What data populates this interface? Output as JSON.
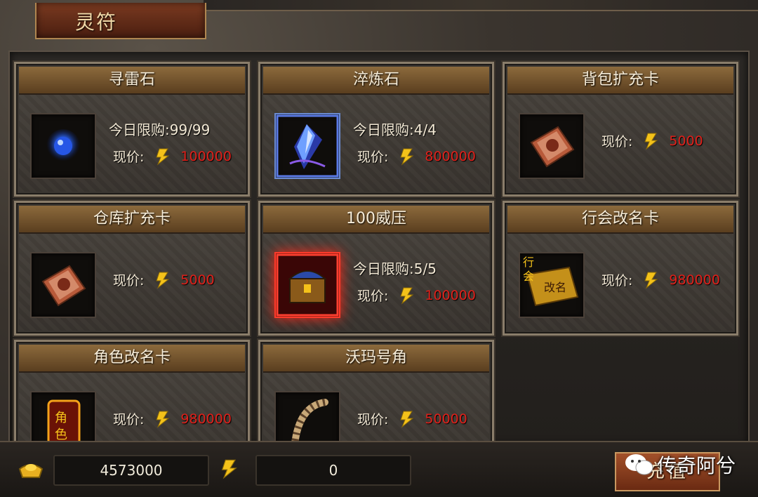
{
  "window": {
    "title": "灵符"
  },
  "items": [
    {
      "name": "寻雷石",
      "limit": "今日限购:99/99",
      "price_label": "现价:",
      "price": "100000",
      "icon": "blue-orb-icon"
    },
    {
      "name": "淬炼石",
      "limit": "今日限购:4/4",
      "price_label": "现价:",
      "price": "800000",
      "icon": "crystal-shard-icon"
    },
    {
      "name": "背包扩充卡",
      "limit": "",
      "price_label": "现价:",
      "price": "5000",
      "icon": "scroll-card-icon"
    },
    {
      "name": "仓库扩充卡",
      "limit": "",
      "price_label": "现价:",
      "price": "5000",
      "icon": "scroll-card-icon"
    },
    {
      "name": "100威压",
      "limit": "今日限购:5/5",
      "price_label": "现价:",
      "price": "100000",
      "icon": "treasure-chest-icon"
    },
    {
      "name": "行会改名卡",
      "limit": "",
      "price_label": "现价:",
      "price": "980000",
      "icon": "guild-rename-card-icon",
      "icon_text": [
        "行",
        "会",
        "改名"
      ]
    },
    {
      "name": "角色改名卡",
      "limit": "",
      "price_label": "现价:",
      "price": "980000",
      "icon": "role-rename-card-icon",
      "icon_text": [
        "角",
        "色"
      ]
    },
    {
      "name": "沃玛号角",
      "limit": "",
      "price_label": "现价:",
      "price": "50000",
      "icon": "horn-icon"
    }
  ],
  "footer": {
    "ingot_amount": "4573000",
    "voucher_amount": "0",
    "recharge_label": "充值",
    "watermark": "传奇阿兮"
  },
  "colors": {
    "price": "#e0201a",
    "card_header": "#8c6a3c",
    "accent_gold": "#f4c21a"
  }
}
